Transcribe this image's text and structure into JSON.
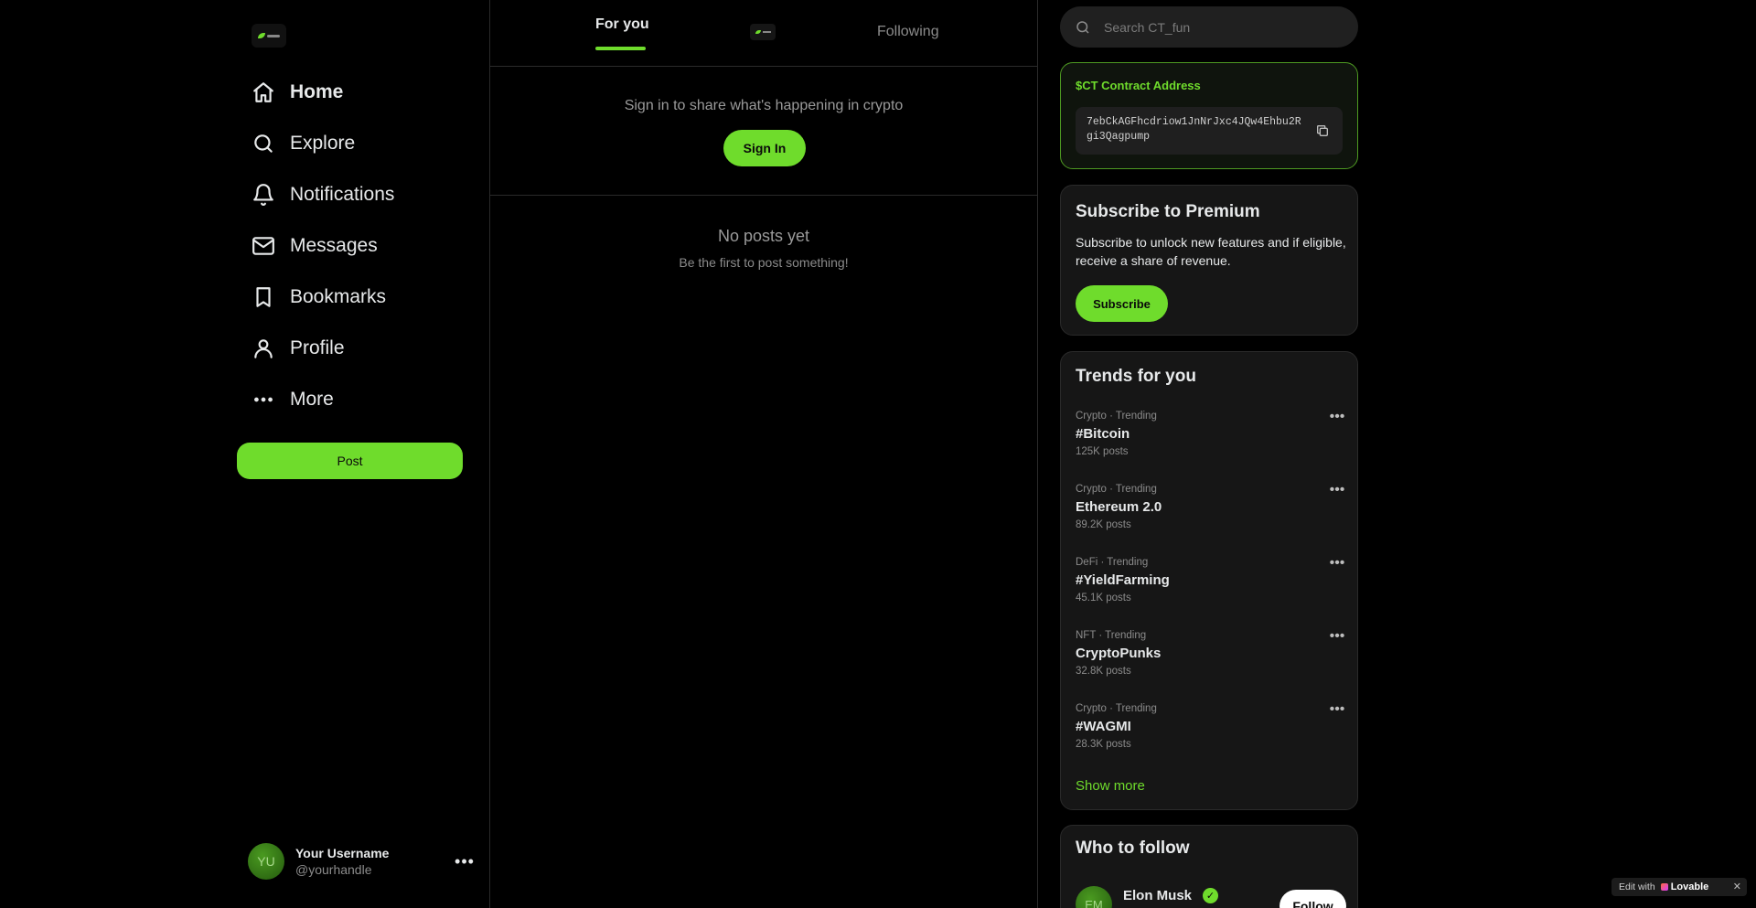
{
  "sidebar": {
    "items": [
      {
        "label": "Home",
        "icon": "home-icon"
      },
      {
        "label": "Explore",
        "icon": "search-icon"
      },
      {
        "label": "Notifications",
        "icon": "bell-icon"
      },
      {
        "label": "Messages",
        "icon": "mail-icon"
      },
      {
        "label": "Bookmarks",
        "icon": "bookmark-icon"
      },
      {
        "label": "Profile",
        "icon": "user-icon"
      },
      {
        "label": "More",
        "icon": "more-dots-icon"
      }
    ],
    "post_label": "Post",
    "user": {
      "initials": "YU",
      "name": "Your Username",
      "handle": "@yourhandle"
    }
  },
  "feed": {
    "tabs": {
      "for_you": "For you",
      "following": "Following"
    },
    "signin_message": "Sign in to share what's happening in crypto",
    "signin_label": "Sign In",
    "empty_title": "No posts yet",
    "empty_subtitle": "Be the first to post something!"
  },
  "search": {
    "placeholder": "Search CT_fun"
  },
  "contract": {
    "title": "$CT Contract Address",
    "address": "7ebCkAGFhcdriow1JnNrJxc4JQw4Ehbu2Rgi3Qagpump"
  },
  "premium": {
    "title": "Subscribe to Premium",
    "text": "Subscribe to unlock new features and if eligible, receive a share of revenue.",
    "button": "Subscribe"
  },
  "trends": {
    "title": "Trends for you",
    "items": [
      {
        "meta": "Crypto · Trending",
        "name": "#Bitcoin",
        "count": "125K posts"
      },
      {
        "meta": "Crypto · Trending",
        "name": "Ethereum 2.0",
        "count": "89.2K posts"
      },
      {
        "meta": "DeFi · Trending",
        "name": "#YieldFarming",
        "count": "45.1K posts"
      },
      {
        "meta": "NFT · Trending",
        "name": "CryptoPunks",
        "count": "32.8K posts"
      },
      {
        "meta": "Crypto · Trending",
        "name": "#WAGMI",
        "count": "28.3K posts"
      }
    ],
    "show_more": "Show more"
  },
  "who_to_follow": {
    "title": "Who to follow",
    "user": {
      "initials": "EM",
      "name": "Elon Musk",
      "button": "Follow"
    }
  },
  "badge": {
    "prefix": "Edit with",
    "brand": "Lovable",
    "close": "✕"
  },
  "colors": {
    "accent": "#6fdc2c",
    "background": "#000000",
    "card": "#161616"
  }
}
